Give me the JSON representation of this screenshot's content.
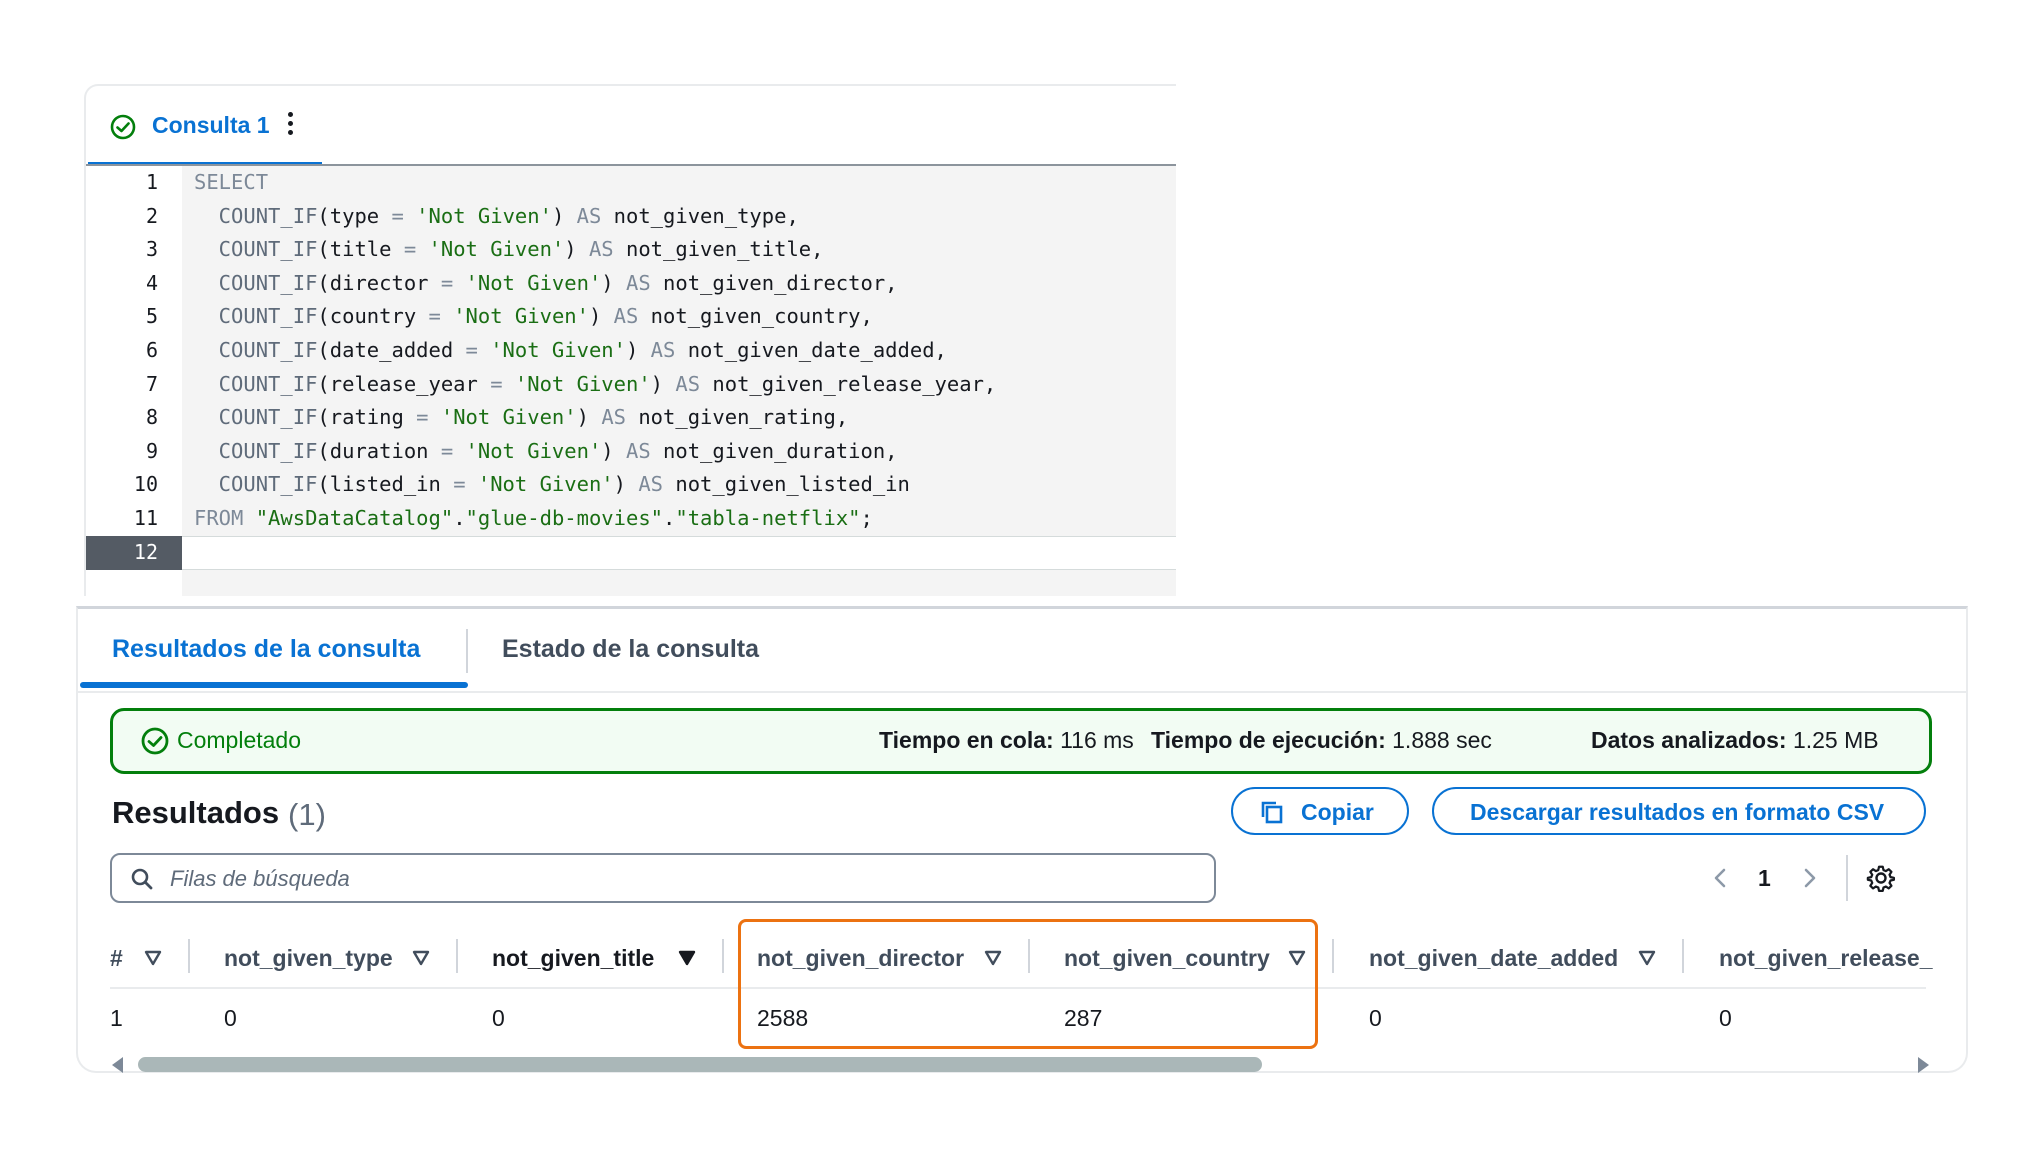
{
  "editor": {
    "tab_label": "Consulta 1",
    "line_numbers": [
      "1",
      "2",
      "3",
      "4",
      "5",
      "6",
      "7",
      "8",
      "9",
      "10",
      "11",
      "12"
    ],
    "lines": [
      [
        [
          "kw",
          "SELECT"
        ]
      ],
      [
        [
          "fn",
          "  COUNT_IF"
        ],
        [
          "tx",
          "(type "
        ],
        [
          "kw",
          "="
        ],
        [
          "st",
          " 'Not Given'"
        ],
        [
          "tx",
          ") "
        ],
        [
          "kw",
          "AS"
        ],
        [
          "tx",
          " not_given_type,"
        ]
      ],
      [
        [
          "fn",
          "  COUNT_IF"
        ],
        [
          "tx",
          "(title "
        ],
        [
          "kw",
          "="
        ],
        [
          "st",
          " 'Not Given'"
        ],
        [
          "tx",
          ") "
        ],
        [
          "kw",
          "AS"
        ],
        [
          "tx",
          " not_given_title,"
        ]
      ],
      [
        [
          "fn",
          "  COUNT_IF"
        ],
        [
          "tx",
          "(director "
        ],
        [
          "kw",
          "="
        ],
        [
          "st",
          " 'Not Given'"
        ],
        [
          "tx",
          ") "
        ],
        [
          "kw",
          "AS"
        ],
        [
          "tx",
          " not_given_director,"
        ]
      ],
      [
        [
          "fn",
          "  COUNT_IF"
        ],
        [
          "tx",
          "(country "
        ],
        [
          "kw",
          "="
        ],
        [
          "st",
          " 'Not Given'"
        ],
        [
          "tx",
          ") "
        ],
        [
          "kw",
          "AS"
        ],
        [
          "tx",
          " not_given_country,"
        ]
      ],
      [
        [
          "fn",
          "  COUNT_IF"
        ],
        [
          "tx",
          "(date_added "
        ],
        [
          "kw",
          "="
        ],
        [
          "st",
          " 'Not Given'"
        ],
        [
          "tx",
          ") "
        ],
        [
          "kw",
          "AS"
        ],
        [
          "tx",
          " not_given_date_added,"
        ]
      ],
      [
        [
          "fn",
          "  COUNT_IF"
        ],
        [
          "tx",
          "(release_year "
        ],
        [
          "kw",
          "="
        ],
        [
          "st",
          " 'Not Given'"
        ],
        [
          "tx",
          ") "
        ],
        [
          "kw",
          "AS"
        ],
        [
          "tx",
          " not_given_release_year,"
        ]
      ],
      [
        [
          "fn",
          "  COUNT_IF"
        ],
        [
          "tx",
          "(rating "
        ],
        [
          "kw",
          "="
        ],
        [
          "st",
          " 'Not Given'"
        ],
        [
          "tx",
          ") "
        ],
        [
          "kw",
          "AS"
        ],
        [
          "tx",
          " not_given_rating,"
        ]
      ],
      [
        [
          "fn",
          "  COUNT_IF"
        ],
        [
          "tx",
          "(duration "
        ],
        [
          "kw",
          "="
        ],
        [
          "st",
          " 'Not Given'"
        ],
        [
          "tx",
          ") "
        ],
        [
          "kw",
          "AS"
        ],
        [
          "tx",
          " not_given_duration,"
        ]
      ],
      [
        [
          "fn",
          "  COUNT_IF"
        ],
        [
          "tx",
          "(listed_in "
        ],
        [
          "kw",
          "="
        ],
        [
          "st",
          " 'Not Given'"
        ],
        [
          "tx",
          ") "
        ],
        [
          "kw",
          "AS"
        ],
        [
          "tx",
          " not_given_listed_in"
        ]
      ],
      [
        [
          "kw",
          "FROM"
        ],
        [
          "st",
          " \"AwsDataCatalog\""
        ],
        [
          "tx",
          "."
        ],
        [
          "st",
          "\"glue-db-movies\""
        ],
        [
          "tx",
          "."
        ],
        [
          "st",
          "\"tabla-netflix\""
        ],
        [
          "tx",
          ";"
        ]
      ],
      []
    ]
  },
  "results": {
    "tab_results": "Resultados de la consulta",
    "tab_status": "Estado de la consulta",
    "status": {
      "state": "Completado",
      "queue_label": "Tiempo en cola:",
      "queue_value": "116 ms",
      "exec_label": "Tiempo de ejecución:",
      "exec_value": "1.888 sec",
      "scanned_label": "Datos analizados:",
      "scanned_value": "1.25 MB"
    },
    "title": "Resultados",
    "count": "(1)",
    "copy_label": "Copiar",
    "csv_label": "Descargar resultados en formato CSV",
    "search_placeholder": "Filas de búsqueda",
    "page": "1",
    "columns": [
      "#",
      "not_given_type",
      "not_given_title",
      "not_given_director",
      "not_given_country",
      "not_given_date_added",
      "not_given_release_"
    ],
    "rows": [
      [
        "1",
        "0",
        "0",
        "2588",
        "287",
        "0",
        "0"
      ]
    ],
    "highlight_color": "#ec7211"
  },
  "colors": {
    "accent": "#0972d3",
    "success": "#037f0c"
  }
}
